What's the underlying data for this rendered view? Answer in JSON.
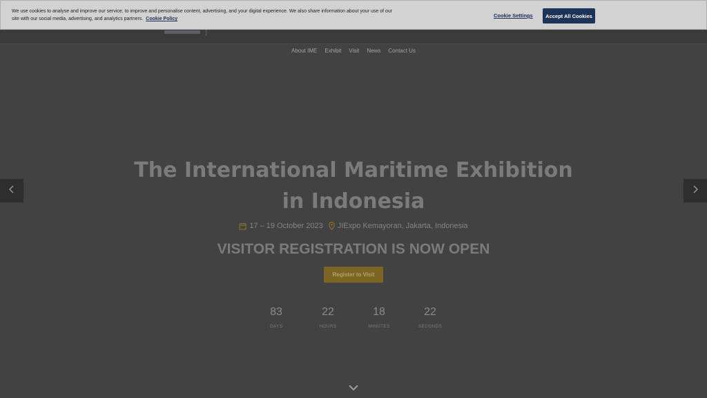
{
  "cookie_banner": {
    "message": "We use cookies to analyse and improve our service, to improve and personalise content, advertising, and your digital experience. We also share information about your use of our site with our social media, advertising, and analytics partners.",
    "policy_link": "Cookie Policy",
    "settings_label": "Cookie Settings",
    "accept_label": "Accept All Cookies"
  },
  "nav": {
    "items": [
      "About IME",
      "Exhibit",
      "Visit",
      "News",
      "Contact Us"
    ]
  },
  "hero": {
    "title_line1": "The International Maritime Exhibition",
    "title_line2": "in Indonesia",
    "date": "17 – 19 October 2023",
    "location": "JIExpo Kemayoran, Jakarta, Indonesia",
    "registration": "VISITOR REGISTRATION IS NOW OPEN",
    "register_button": "Register to Visit"
  },
  "countdown": {
    "days": {
      "value": "83",
      "label": "DAYS"
    },
    "hours": {
      "value": "22",
      "label": "HOURS"
    },
    "minutes": {
      "value": "18",
      "label": "MINUTES"
    },
    "seconds": {
      "value": "22",
      "label": "SECONDS"
    }
  },
  "icons": {
    "calendar": "calendar-icon",
    "location": "map-pin-icon",
    "prev": "chevron-left-icon",
    "next": "chevron-right-icon",
    "scroll": "chevron-down-icon"
  },
  "colors": {
    "overlay_bg": "#424242",
    "accent_gold": "#7c6624",
    "cookie_button": "#1e3358"
  }
}
